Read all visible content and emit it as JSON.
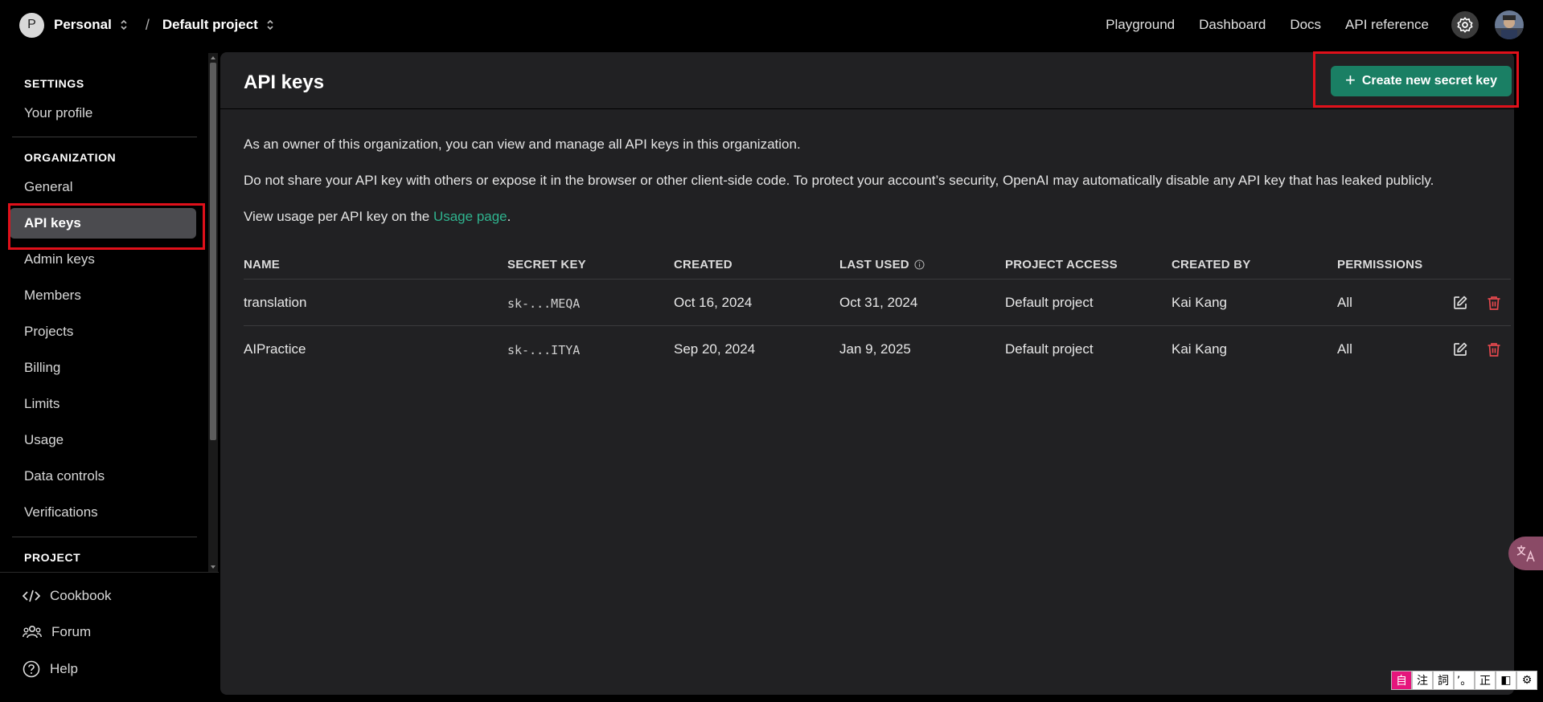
{
  "topbar": {
    "org_initial": "P",
    "org_name": "Personal",
    "separator": "/",
    "project_name": "Default project",
    "nav": [
      "Playground",
      "Dashboard",
      "Docs",
      "API reference"
    ]
  },
  "sidebar": {
    "section_settings": "SETTINGS",
    "your_profile": "Your profile",
    "section_org": "ORGANIZATION",
    "org_items": [
      "General",
      "API keys",
      "Admin keys",
      "Members",
      "Projects",
      "Billing",
      "Limits",
      "Usage",
      "Data controls",
      "Verifications"
    ],
    "section_project": "PROJECT",
    "bottom": [
      "Cookbook",
      "Forum",
      "Help"
    ]
  },
  "main": {
    "title": "API keys",
    "create_button": "Create new secret key",
    "para1": "As an owner of this organization, you can view and manage all API keys in this organization.",
    "para2": "Do not share your API key with others or expose it in the browser or other client-side code. To protect your account’s security, OpenAI may automatically disable any API key that has leaked publicly.",
    "para3_prefix": "View usage per API key on the ",
    "para3_link": "Usage page",
    "para3_suffix": ".",
    "columns": [
      "NAME",
      "SECRET KEY",
      "CREATED",
      "LAST USED",
      "PROJECT ACCESS",
      "CREATED BY",
      "PERMISSIONS"
    ],
    "rows": [
      {
        "name": "translation",
        "key": "sk-...MEQA",
        "created": "Oct 16, 2024",
        "last_used": "Oct 31, 2024",
        "project": "Default project",
        "created_by": "Kai Kang",
        "permissions": "All"
      },
      {
        "name": "AIPractice",
        "key": "sk-...ITYA",
        "created": "Sep 20, 2024",
        "last_used": "Jan 9, 2025",
        "project": "Default project",
        "created_by": "Kai Kang",
        "permissions": "All"
      }
    ]
  },
  "ime": [
    "自",
    "注",
    "詞",
    "’。",
    "正",
    "◧",
    "⚙"
  ],
  "colors": {
    "accent": "#1a7f64",
    "link": "#2fb38e",
    "delete": "#e5484d",
    "highlight": "#e0101a"
  }
}
